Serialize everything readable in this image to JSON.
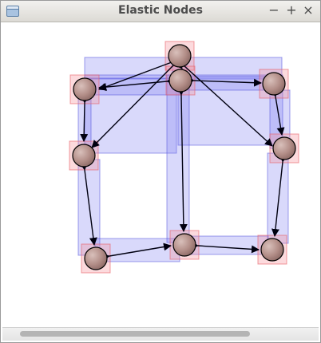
{
  "window": {
    "title": "Elastic Nodes",
    "minimize_label": "−",
    "maximize_label": "+",
    "close_label": "×"
  },
  "icons": {
    "app": "window-icon",
    "minimize": "minimize-icon",
    "maximize": "maximize-icon",
    "close": "close-icon"
  },
  "colors": {
    "node_fill": "#b9958f",
    "node_stroke": "#000000",
    "node_box": "#f7c4c8",
    "edge_box": "#c9c9f6",
    "edge_line": "#000000",
    "background": "#ffffff"
  },
  "graph": {
    "node_count": 9,
    "edges": [
      [
        "top-center",
        "upper-center"
      ],
      [
        "top-center",
        "upper-left"
      ],
      [
        "top-center",
        "middle-left"
      ],
      [
        "top-center",
        "upper-right"
      ],
      [
        "upper-center",
        "upper-left"
      ],
      [
        "upper-center",
        "upper-right"
      ],
      [
        "upper-center",
        "middle-right"
      ],
      [
        "upper-center",
        "bottom-center"
      ],
      [
        "upper-left",
        "middle-left"
      ],
      [
        "upper-right",
        "middle-right"
      ],
      [
        "middle-left",
        "bottom-left"
      ],
      [
        "middle-right",
        "bottom-right"
      ],
      [
        "bottom-left",
        "bottom-center"
      ],
      [
        "bottom-center",
        "bottom-right"
      ]
    ]
  }
}
